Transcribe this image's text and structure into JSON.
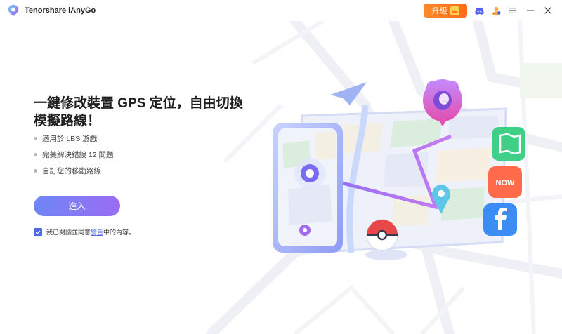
{
  "app": {
    "title": "Tenorshare iAnyGo",
    "logo_icon": "ianygo-logo-icon"
  },
  "titlebar": {
    "upgrade_label": "升級",
    "icons": [
      "discord-icon",
      "account-icon",
      "menu-icon",
      "minimize-icon",
      "close-icon"
    ]
  },
  "main": {
    "headline": "一鍵修改裝置 GPS 定位，自由切換模擬路線！",
    "features": [
      "適用於 LBS 遊戲",
      "完美解決錯誤 12 問題",
      "自訂您的移動路線"
    ],
    "enter_label": "進入",
    "agree_prefix": "我已閱讀並同意",
    "agree_link": "警告",
    "agree_suffix": "中的內容。",
    "agree_checked": true
  },
  "illustration": {
    "app_badges": [
      "map-app-icon",
      "now-app-icon",
      "facebook-app-icon"
    ],
    "now_badge_text": "NOW"
  },
  "colors": {
    "accent": "#4f66e8",
    "button_gradient_start": "#6e86f7",
    "button_gradient_end": "#9a6cf2",
    "upgrade_orange": "#ff7a22"
  }
}
